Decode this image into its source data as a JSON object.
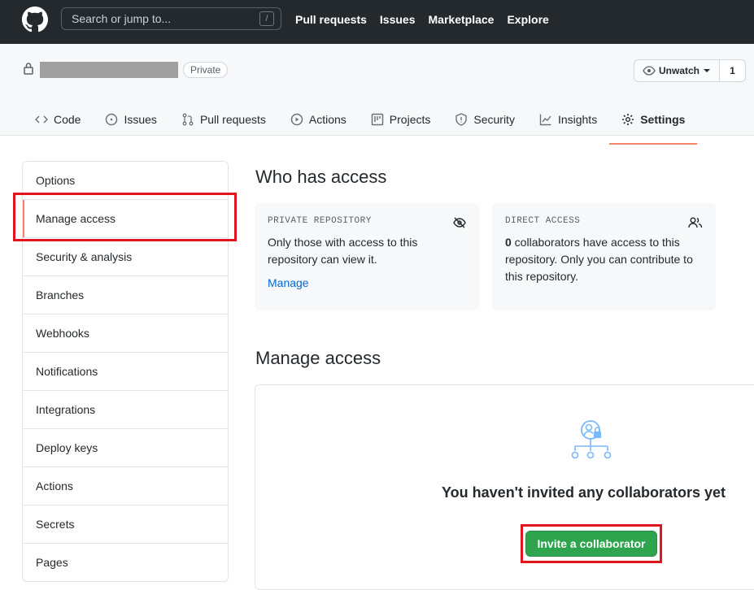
{
  "header": {
    "search_placeholder": "Search or jump to...",
    "search_shortcut": "/",
    "nav": [
      "Pull requests",
      "Issues",
      "Marketplace",
      "Explore"
    ]
  },
  "repo": {
    "visibility_badge": "Private",
    "watch_label": "Unwatch",
    "watch_count": "1"
  },
  "tabs": [
    {
      "label": "Code",
      "icon": "code-icon"
    },
    {
      "label": "Issues",
      "icon": "issue-icon"
    },
    {
      "label": "Pull requests",
      "icon": "pull-request-icon"
    },
    {
      "label": "Actions",
      "icon": "play-icon"
    },
    {
      "label": "Projects",
      "icon": "project-icon"
    },
    {
      "label": "Security",
      "icon": "shield-icon"
    },
    {
      "label": "Insights",
      "icon": "graph-icon"
    },
    {
      "label": "Settings",
      "icon": "gear-icon",
      "selected": true
    }
  ],
  "sidebar": {
    "items": [
      "Options",
      "Manage access",
      "Security & analysis",
      "Branches",
      "Webhooks",
      "Notifications",
      "Integrations",
      "Deploy keys",
      "Actions",
      "Secrets",
      "Pages"
    ],
    "active": "Manage access"
  },
  "main": {
    "who_title": "Who has access",
    "private_card": {
      "label": "PRIVATE REPOSITORY",
      "desc": "Only those with access to this repository can view it.",
      "link": "Manage"
    },
    "direct_card": {
      "label": "DIRECT ACCESS",
      "count": "0",
      "desc": " collaborators have access to this repository. Only you can contribute to this repository."
    },
    "manage_title": "Manage access",
    "empty_title": "You haven't invited any collaborators yet",
    "invite_button": "Invite a collaborator"
  },
  "colors": {
    "accent_tab": "#f9826c",
    "primary_button": "#2ea44f",
    "highlight_box": "#e0161e",
    "link": "#0366d6"
  }
}
